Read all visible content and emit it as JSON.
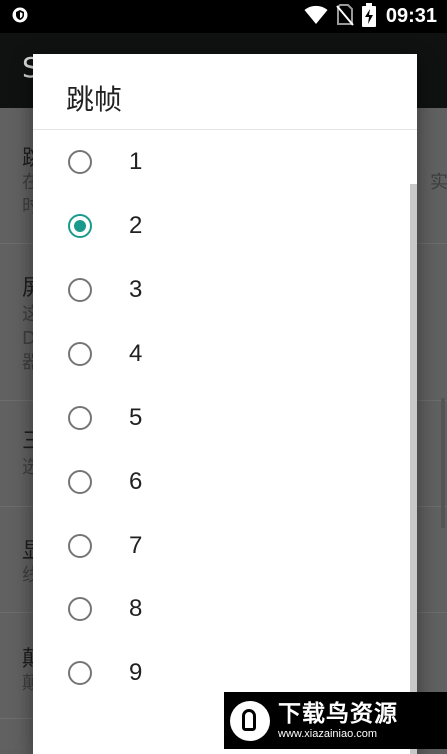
{
  "status_bar": {
    "time": "09:31",
    "icons": [
      "shield-icon",
      "wifi-icon",
      "no-sim-icon",
      "battery-charging-icon"
    ]
  },
  "app_bar": {
    "title_fragment": "S"
  },
  "background_list": {
    "rows": [
      {
        "title": "跳",
        "sub": [
          "在",
          "时"
        ],
        "sub_right": "实"
      },
      {
        "title": "屏",
        "sub": [
          "这",
          "D",
          "器"
        ]
      },
      {
        "title": "三",
        "sub": [
          "选"
        ]
      },
      {
        "title": "显",
        "sub": [
          "线"
        ]
      },
      {
        "title": "颠",
        "sub": [
          "颠"
        ]
      }
    ]
  },
  "dialog": {
    "title": "跳帧",
    "selected": "2",
    "options": [
      {
        "label": "1",
        "checked": false
      },
      {
        "label": "2",
        "checked": true
      },
      {
        "label": "3",
        "checked": false
      },
      {
        "label": "4",
        "checked": false
      },
      {
        "label": "5",
        "checked": false
      },
      {
        "label": "6",
        "checked": false
      },
      {
        "label": "7",
        "checked": false
      },
      {
        "label": "8",
        "checked": false
      },
      {
        "label": "9",
        "checked": false
      }
    ]
  },
  "watermark": {
    "text": "下载鸟资源",
    "url": "www.xiazainiao.com"
  },
  "colors": {
    "accent": "#1a9a8c",
    "status_bar": "#000000",
    "scrim": "#616161"
  }
}
